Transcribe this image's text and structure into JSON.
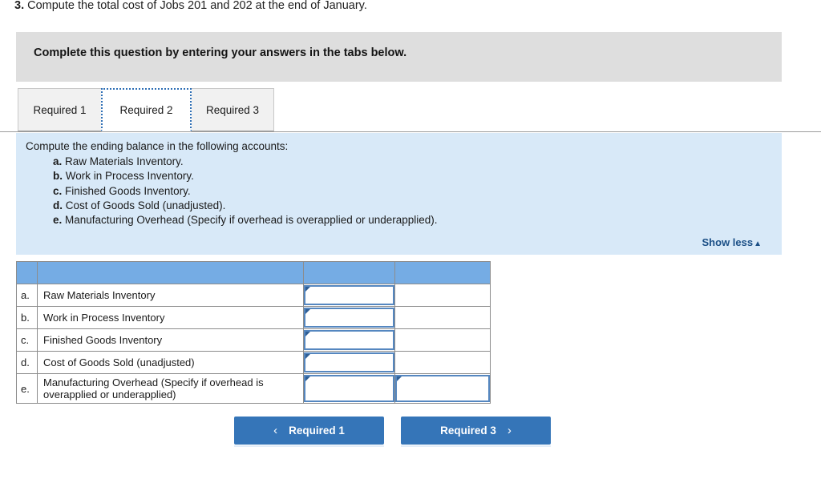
{
  "question": {
    "number": "3.",
    "text": "Compute the total cost of Jobs 201 and 202 at the end of January."
  },
  "banner": {
    "text": "Complete this question by entering your answers in the tabs below."
  },
  "tabs": [
    {
      "label": "Required 1",
      "active": false
    },
    {
      "label": "Required 2",
      "active": true
    },
    {
      "label": "Required 3",
      "active": false
    }
  ],
  "requirement_panel": {
    "intro": "Compute the ending balance in the following accounts:",
    "items": [
      {
        "letter": "a.",
        "text": "Raw Materials Inventory."
      },
      {
        "letter": "b.",
        "text": "Work in Process Inventory."
      },
      {
        "letter": "c.",
        "text": "Finished Goods Inventory."
      },
      {
        "letter": "d.",
        "text": "Cost of Goods Sold (unadjusted)."
      },
      {
        "letter": "e.",
        "text": "Manufacturing Overhead (Specify if overhead is overapplied or underapplied)."
      }
    ],
    "show_less_label": "Show less",
    "show_less_caret": "▲"
  },
  "answer_table": {
    "header": {
      "col_letter": "",
      "col_label": "",
      "col_input": "",
      "col_input2": ""
    },
    "rows": [
      {
        "letter": "a.",
        "label": "Raw Materials Inventory",
        "value1": "",
        "value2": "",
        "has_second_input": false
      },
      {
        "letter": "b.",
        "label": "Work in Process Inventory",
        "value1": "",
        "value2": "",
        "has_second_input": false
      },
      {
        "letter": "c.",
        "label": "Finished Goods Inventory",
        "value1": "",
        "value2": "",
        "has_second_input": false
      },
      {
        "letter": "d.",
        "label": "Cost of Goods Sold (unadjusted)",
        "value1": "",
        "value2": "",
        "has_second_input": false
      },
      {
        "letter": "e.",
        "label": "Manufacturing Overhead (Specify if overhead is overapplied or underapplied)",
        "value1": "",
        "value2": "",
        "has_second_input": true
      }
    ]
  },
  "nav": {
    "prev_label": "Required 1",
    "prev_icon": "‹",
    "next_label": "Required 3",
    "next_icon": "›"
  },
  "colors": {
    "banner_gray": "#dedede",
    "panel_blue": "#d8e9f8",
    "table_header_blue": "#75ace4",
    "button_blue": "#3575b8",
    "link_blue": "#1b4f86",
    "input_border_blue": "#5587c0"
  }
}
